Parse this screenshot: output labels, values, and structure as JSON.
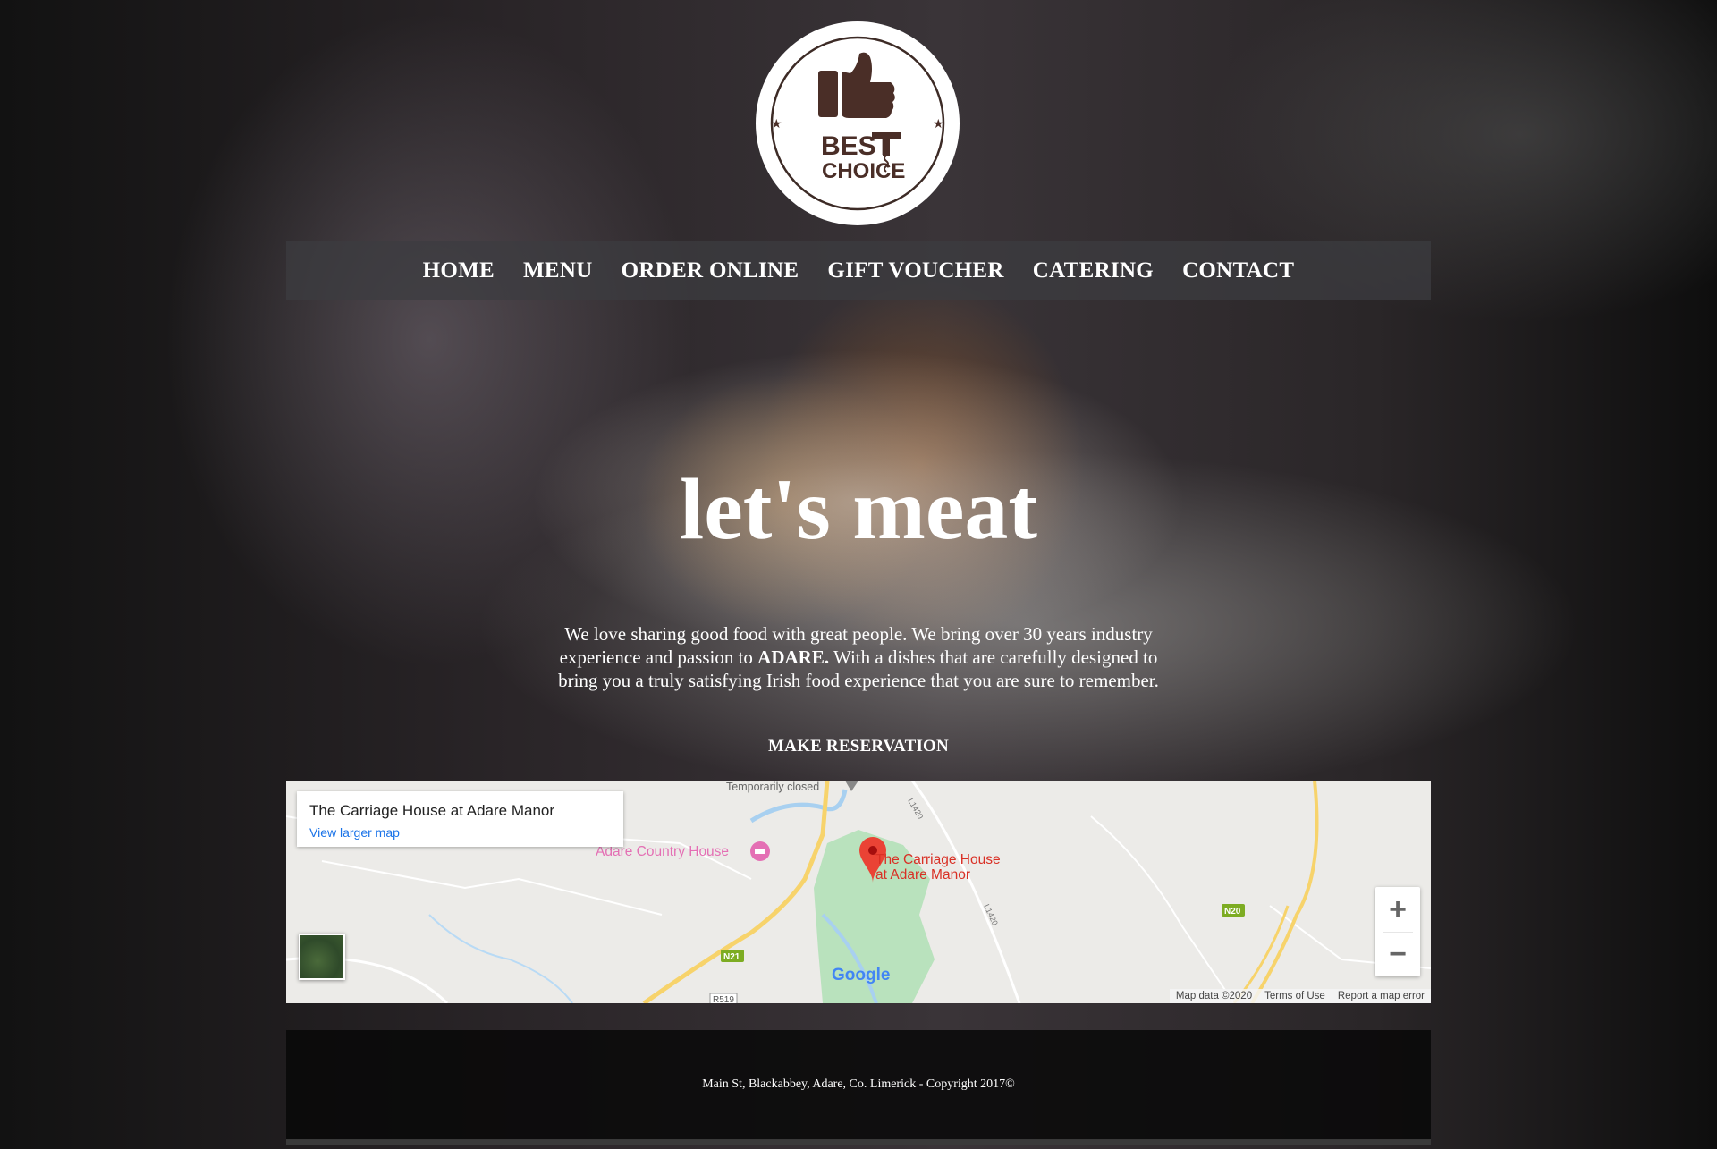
{
  "logo": {
    "line1": "BEST",
    "line2": "CHOICE"
  },
  "nav": {
    "items": [
      {
        "label": "HOME"
      },
      {
        "label": "MENU"
      },
      {
        "label": "ORDER ONLINE"
      },
      {
        "label": "GIFT VOUCHER"
      },
      {
        "label": "CATERING"
      },
      {
        "label": "CONTACT"
      }
    ]
  },
  "hero": {
    "title": "let's meat",
    "text_before": "We love sharing good food with great people. We bring over 30 years industry experience and passion to ",
    "text_bold": "ADARE.",
    "text_after": " With a dishes that are carefully designed to bring you a truly satisfying Irish food experience that you are sure to remember.",
    "cta": "MAKE RESERVATION"
  },
  "map": {
    "card_title": "The Carriage House at Adare Manor",
    "card_link": "View larger map",
    "marker_label_1": "The Carriage House",
    "marker_label_2": "at Adare Manor",
    "poi_label": "Adare Country House",
    "closed_label": "Temporarily closed",
    "road_labels": {
      "n21": "N21",
      "n20": "N20",
      "r519": "R519",
      "l1420a": "L1420",
      "l1420b": "L1420"
    },
    "zoom_in": "+",
    "zoom_out": "−",
    "google": "Google",
    "footer_items": [
      "Map data ©2020",
      "Terms of Use",
      "Report a map error"
    ]
  },
  "footer": {
    "text": "Main St, Blackabbey, Adare, Co. Limerick - Copyright 2017©"
  }
}
